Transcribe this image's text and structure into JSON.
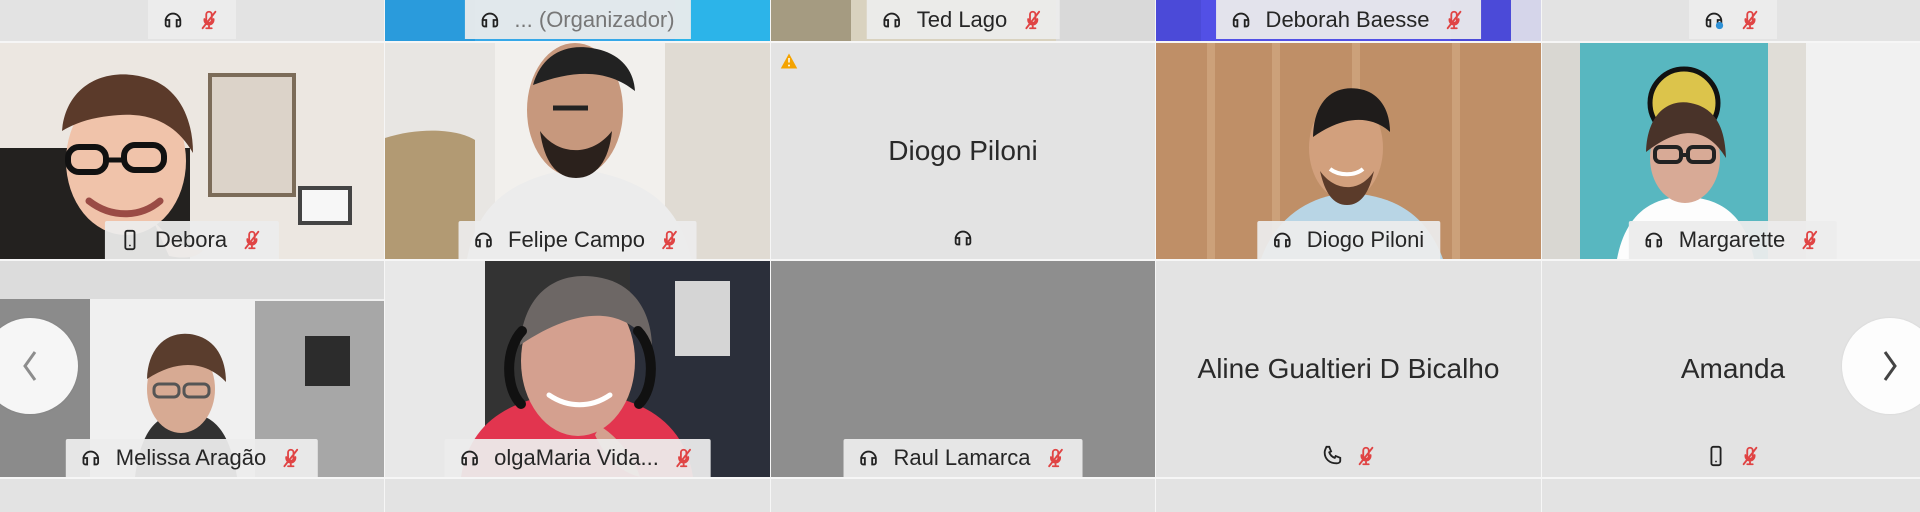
{
  "top_row": [
    {
      "label": "",
      "status": "headset",
      "mic": "muted"
    },
    {
      "label": "... (Organizador)",
      "status": "headset",
      "mic": "none"
    },
    {
      "label": "Ted Lago",
      "status": "headset",
      "mic": "muted"
    },
    {
      "label": "Deborah Baesse",
      "status": "headset",
      "mic": "muted"
    },
    {
      "label": "",
      "status": "headset-sync",
      "mic": "muted"
    }
  ],
  "participants": [
    {
      "name": "Debora",
      "device": "phone",
      "mic": "muted",
      "view": "video"
    },
    {
      "name": "Felipe Campo",
      "device": "headset",
      "mic": "muted",
      "view": "video"
    },
    {
      "name": "Diogo Piloni",
      "device": "headset",
      "mic": "none",
      "view": "avatar",
      "warning": true
    },
    {
      "name": "Diogo Piloni",
      "device": "headset",
      "mic": "none",
      "view": "video"
    },
    {
      "name": "Margarette",
      "device": "headset",
      "mic": "muted",
      "view": "video"
    },
    {
      "name": "Melissa Aragão",
      "device": "headset",
      "mic": "muted",
      "view": "video"
    },
    {
      "name": "olgaMaria Vida...",
      "device": "headset",
      "mic": "muted",
      "view": "video"
    },
    {
      "name": "Raul Lamarca",
      "device": "headset",
      "mic": "muted",
      "view": "empty"
    },
    {
      "name": "Aline Gualtieri D Bicalho",
      "device": "phone-call",
      "mic": "muted",
      "view": "avatar"
    },
    {
      "name": "Amanda",
      "device": "phone",
      "mic": "muted",
      "view": "avatar"
    }
  ],
  "colors": {
    "background": "#e9e9e9",
    "tile": "#e2e2e2",
    "dark_tile": "#8e8e8e",
    "label_background": "#ececec",
    "muted_red": "#e04444",
    "warning": "#f4a300"
  },
  "icons": {
    "headset": "headset-icon",
    "mic_muted": "microphone-muted-icon",
    "phone": "phone-icon",
    "phone_call": "phone-call-icon",
    "warning": "warning-icon",
    "left_arrow": "chevron-left-icon",
    "right_arrow": "chevron-right-icon"
  }
}
